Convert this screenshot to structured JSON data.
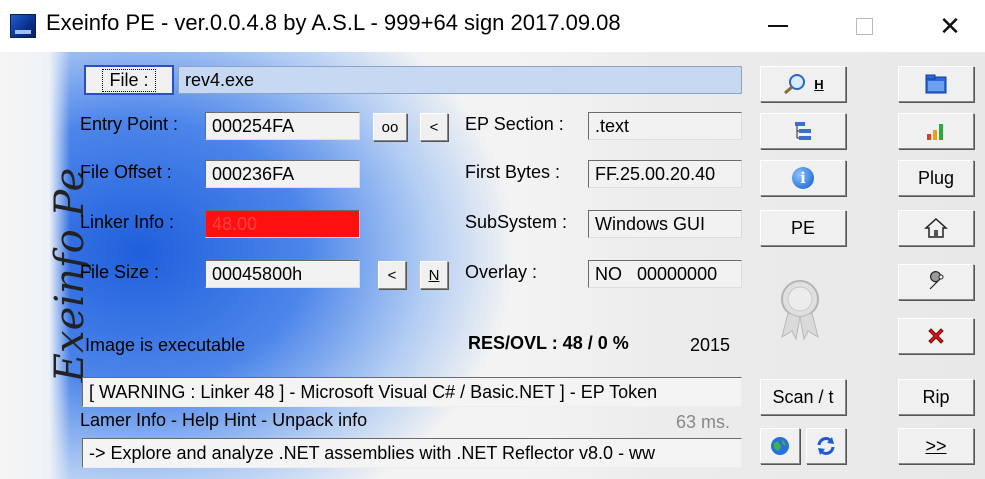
{
  "window": {
    "title": "Exeinfo PE - ver.0.0.4.8  by A.S.L -  999+64 sign  2017.09.08",
    "minimize_glyph": "—",
    "close_glyph": "✕"
  },
  "logo_text": "Exeinfo Pe",
  "file": {
    "button_label": "File :",
    "path": "rev4.exe"
  },
  "fields": {
    "entry_point_label": "Entry Point :",
    "entry_point_value": "000254FA",
    "oo_label": "oo",
    "lt_label": "<",
    "file_offset_label": "File Offset :",
    "file_offset_value": "000236FA",
    "linker_info_label": "Linker Info :",
    "linker_info_value": "48.00",
    "file_size_label": "File Size :",
    "file_size_value": "00045800h",
    "size_lt_label": "<",
    "size_n_label": "N",
    "ep_section_label": "EP Section :",
    "ep_section_value": ".text",
    "first_bytes_label": "First Bytes :",
    "first_bytes_value": "FF.25.00.20.40",
    "subsystem_label": "SubSystem :",
    "subsystem_value": "Windows GUI",
    "overlay_label": "Overlay :",
    "overlay_value": "NO   00000000"
  },
  "info": {
    "image_status": "Image is executable",
    "res_ovl": "RES/OVL : 48 / 0 %",
    "year": "2015"
  },
  "status": {
    "warning_line": "[ WARNING : Linker 48 ] - Microsoft Visual C# / Basic.NET ]   - EP Token",
    "lamer_info": "Lamer Info - Help Hint - Unpack info",
    "timing": "63 ms.",
    "hint_line": "-> Explore and analyze .NET assemblies with .NET Reflector v8.0 - ww"
  },
  "middle_buttons": {
    "h_label": "H",
    "pe_label": "PE",
    "scan_label": "Scan / t"
  },
  "right_buttons": {
    "plug_label": "Plug",
    "rip_label": "Rip",
    "next_label": ">>"
  }
}
